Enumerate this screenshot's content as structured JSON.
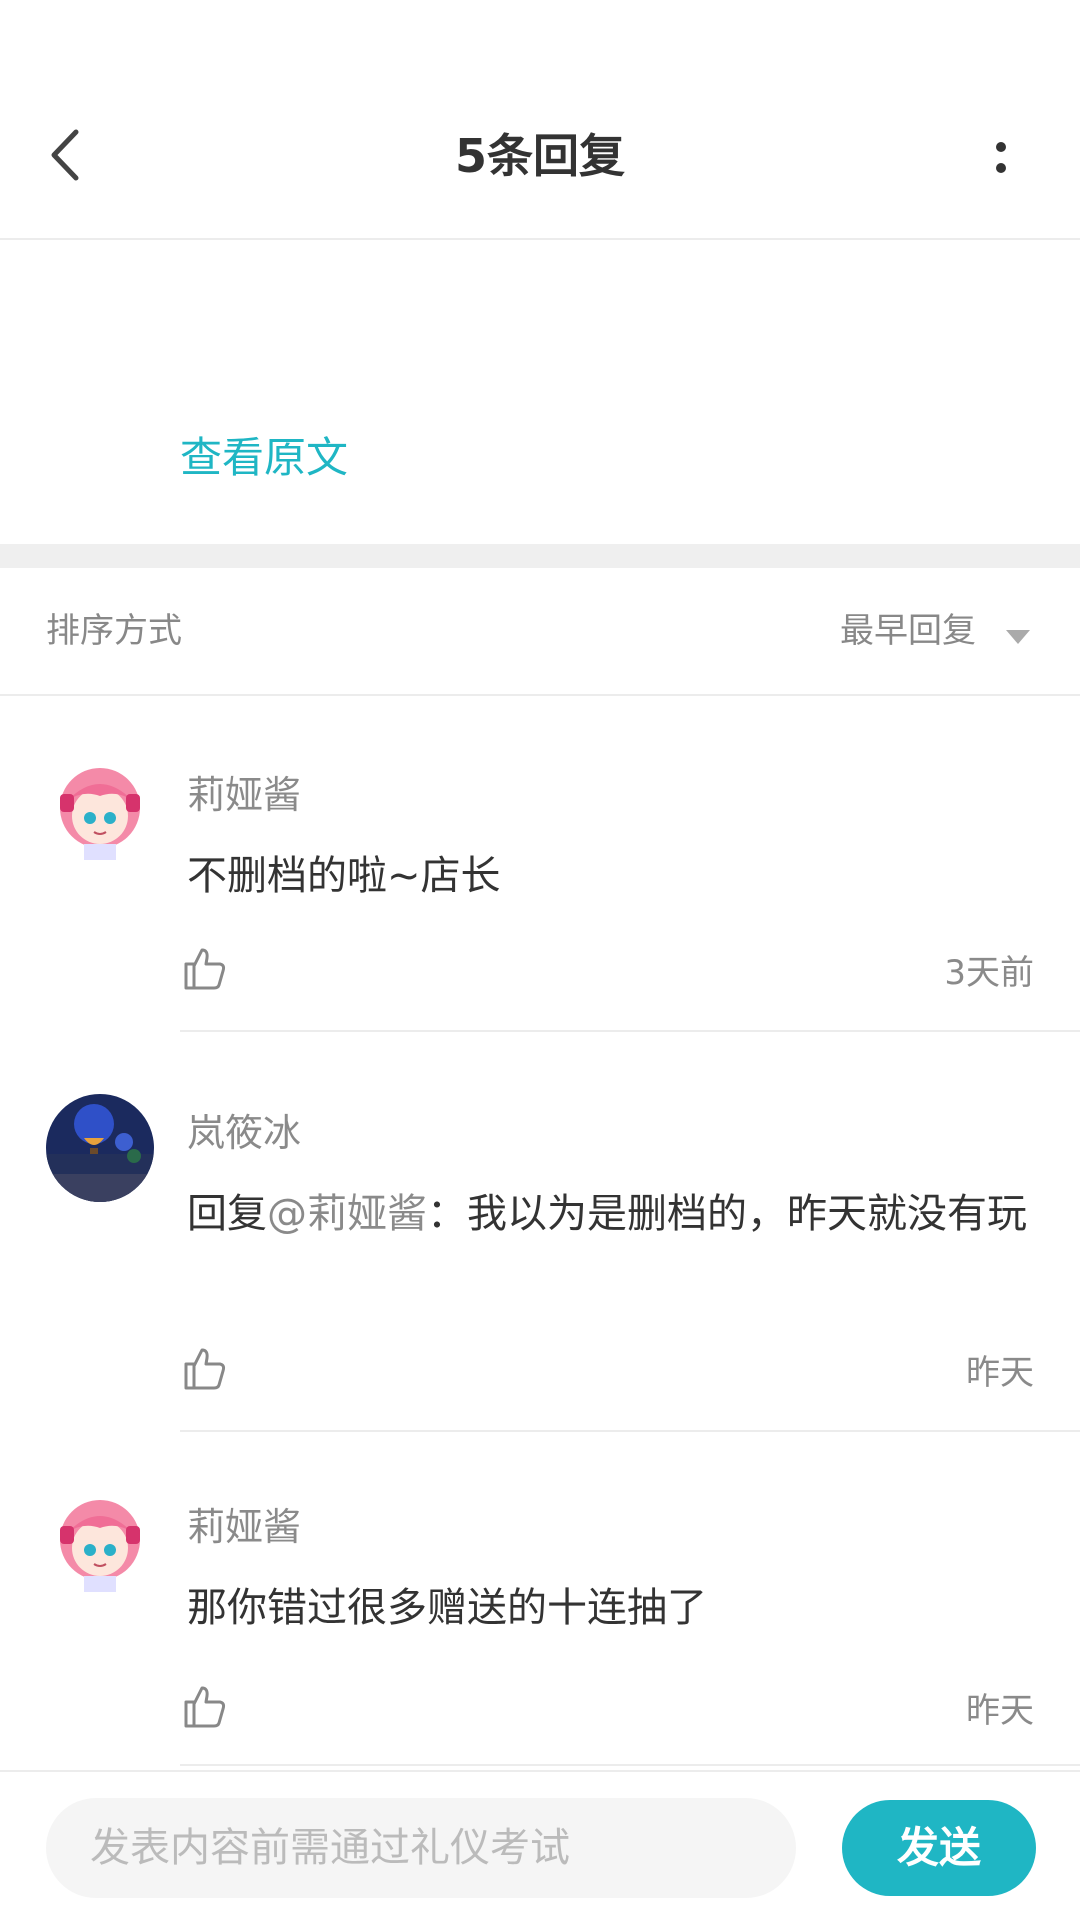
{
  "header": {
    "title": "5条回复",
    "back_icon": "chevron-left-icon",
    "more_icon": "more-vertical-icon"
  },
  "original": {
    "link_label": "查看原文",
    "link_color": "#1fb6c4"
  },
  "sort": {
    "label": "排序方式",
    "value": "最早回复"
  },
  "comments": [
    {
      "user": "莉娅酱",
      "text": "不删档的啦~店长",
      "time": "3天前",
      "avatar": "anime-girl-avatar"
    },
    {
      "user": "岚筱冰",
      "reply_prefix": "回复",
      "mention": "@莉娅酱",
      "text": "：我以为是删档的，昨天就没有玩",
      "time": "昨天",
      "avatar": "hot-air-balloon-avatar"
    },
    {
      "user": "莉娅酱",
      "text": "那你错过很多赠送的十连抽了",
      "time": "昨天",
      "avatar": "anime-girl-avatar"
    }
  ],
  "composer": {
    "placeholder": "发表内容前需通过礼仪考试",
    "send_label": "发送"
  }
}
